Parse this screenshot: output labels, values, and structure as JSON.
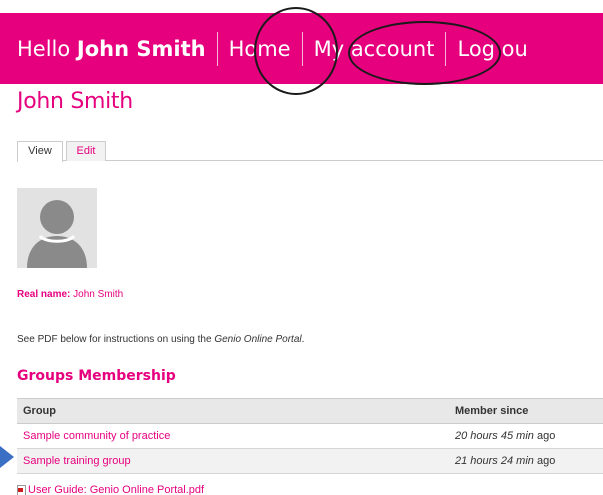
{
  "header": {
    "greeting": "Hello",
    "user_name": "John Smith",
    "nav": [
      "Home",
      "My account",
      "Log ou"
    ],
    "brand_color": "#e6007e"
  },
  "profile": {
    "title": "John Smith",
    "tabs": [
      "View",
      "Edit"
    ],
    "active_tab": "View",
    "real_name_label": "Real name:",
    "real_name_value": "John Smith",
    "note_prefix": "See PDF below for instructions on using the",
    "note_emphasis": "Genio Online Portal",
    "note_suffix": "."
  },
  "groups": {
    "title": "Groups Membership",
    "columns": [
      "Group",
      "Member since"
    ],
    "rows": [
      {
        "group": "Sample community of practice",
        "since": "20 hours 45 min",
        "since_suffix": "ago"
      },
      {
        "group": "Sample training group",
        "since": "21 hours 24 min",
        "since_suffix": "ago"
      }
    ]
  },
  "attachment": {
    "label": "User Guide: Genio Online Portal.pdf",
    "icon": "pdf-icon"
  },
  "annotations": {
    "circle_color": "#1a1a1a",
    "arrow_color": "#3b6fc4"
  }
}
